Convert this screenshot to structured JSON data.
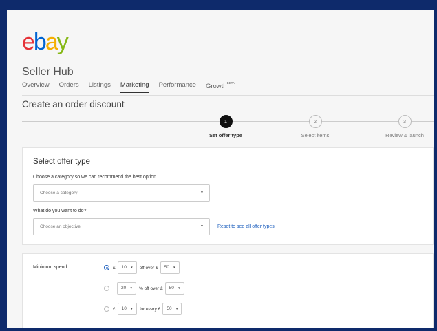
{
  "brand": {
    "letters": [
      "e",
      "b",
      "a",
      "y"
    ]
  },
  "hub": {
    "title": "Seller Hub"
  },
  "nav": {
    "tabs": [
      {
        "label": "Overview"
      },
      {
        "label": "Orders"
      },
      {
        "label": "Listings"
      },
      {
        "label": "Marketing"
      },
      {
        "label": "Performance"
      },
      {
        "label": "Growth",
        "badge": "BETA"
      }
    ],
    "active": "Marketing"
  },
  "page": {
    "title": "Create an order discount"
  },
  "steps": [
    {
      "number": "1",
      "label": "Set offer type"
    },
    {
      "number": "2",
      "label": "Select items"
    },
    {
      "number": "3",
      "label": "Review & launch"
    }
  ],
  "offer_type": {
    "title": "Select offer type",
    "category_question": "Choose a category so we can recommend the best option",
    "category_placeholder": "Choose a category",
    "objective_question": "What do you want to do?",
    "objective_placeholder": "Choose an objective",
    "reset_link": "Reset to see all offer types"
  },
  "minimum_spend": {
    "label": "Minimum spend",
    "options": [
      {
        "prefix": "£",
        "amount": "10",
        "text": "off over £",
        "threshold": "50",
        "selected": true
      },
      {
        "prefix": "",
        "amount": "20",
        "text": "% off over £",
        "threshold": "50",
        "selected": false
      },
      {
        "prefix": "£",
        "amount": "10",
        "text": "for every £",
        "threshold": "50",
        "selected": false
      }
    ]
  },
  "colors": {
    "frame_bg": "#0e2a6b",
    "link": "#1a5dbd",
    "logo_e": "#e53238",
    "logo_b": "#0064d2",
    "logo_a": "#f5af02",
    "logo_y": "#86b817"
  }
}
